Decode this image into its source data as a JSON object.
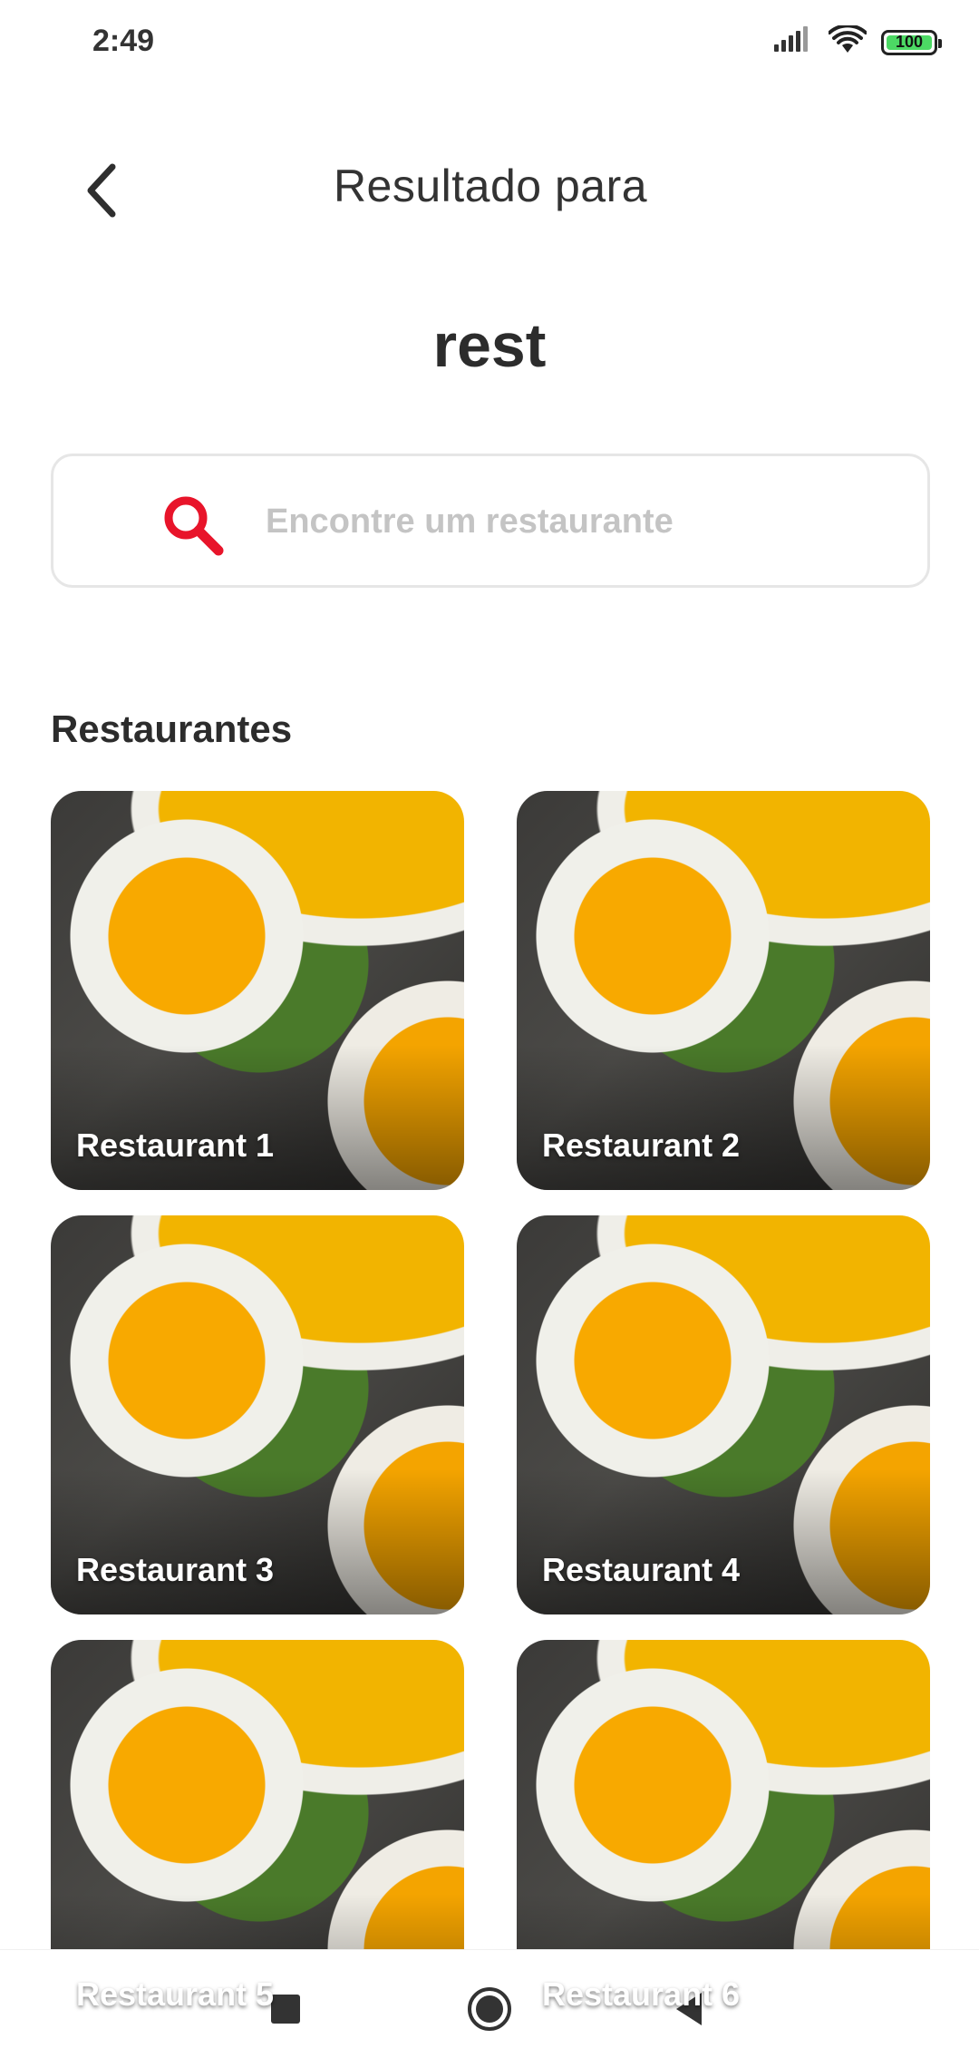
{
  "status_bar": {
    "time": "2:49",
    "battery_level": "100",
    "signal_icon": "signal-icon",
    "wifi_icon": "wifi-icon"
  },
  "header": {
    "title": "Resultado para",
    "back_icon": "chevron-left-icon"
  },
  "query": "rest",
  "search": {
    "placeholder": "Encontre um restaurante",
    "value": "",
    "icon": "search-icon",
    "icon_color": "#e8142a"
  },
  "section_title": "Restaurantes",
  "restaurants": [
    {
      "name": "Restaurant 1"
    },
    {
      "name": "Restaurant 2"
    },
    {
      "name": "Restaurant 3"
    },
    {
      "name": "Restaurant 4"
    },
    {
      "name": "Restaurant 5"
    },
    {
      "name": "Restaurant 6"
    }
  ],
  "nav_bar": {
    "recents_icon": "square-icon",
    "home_icon": "circle-icon",
    "back_icon": "triangle-back-icon"
  }
}
